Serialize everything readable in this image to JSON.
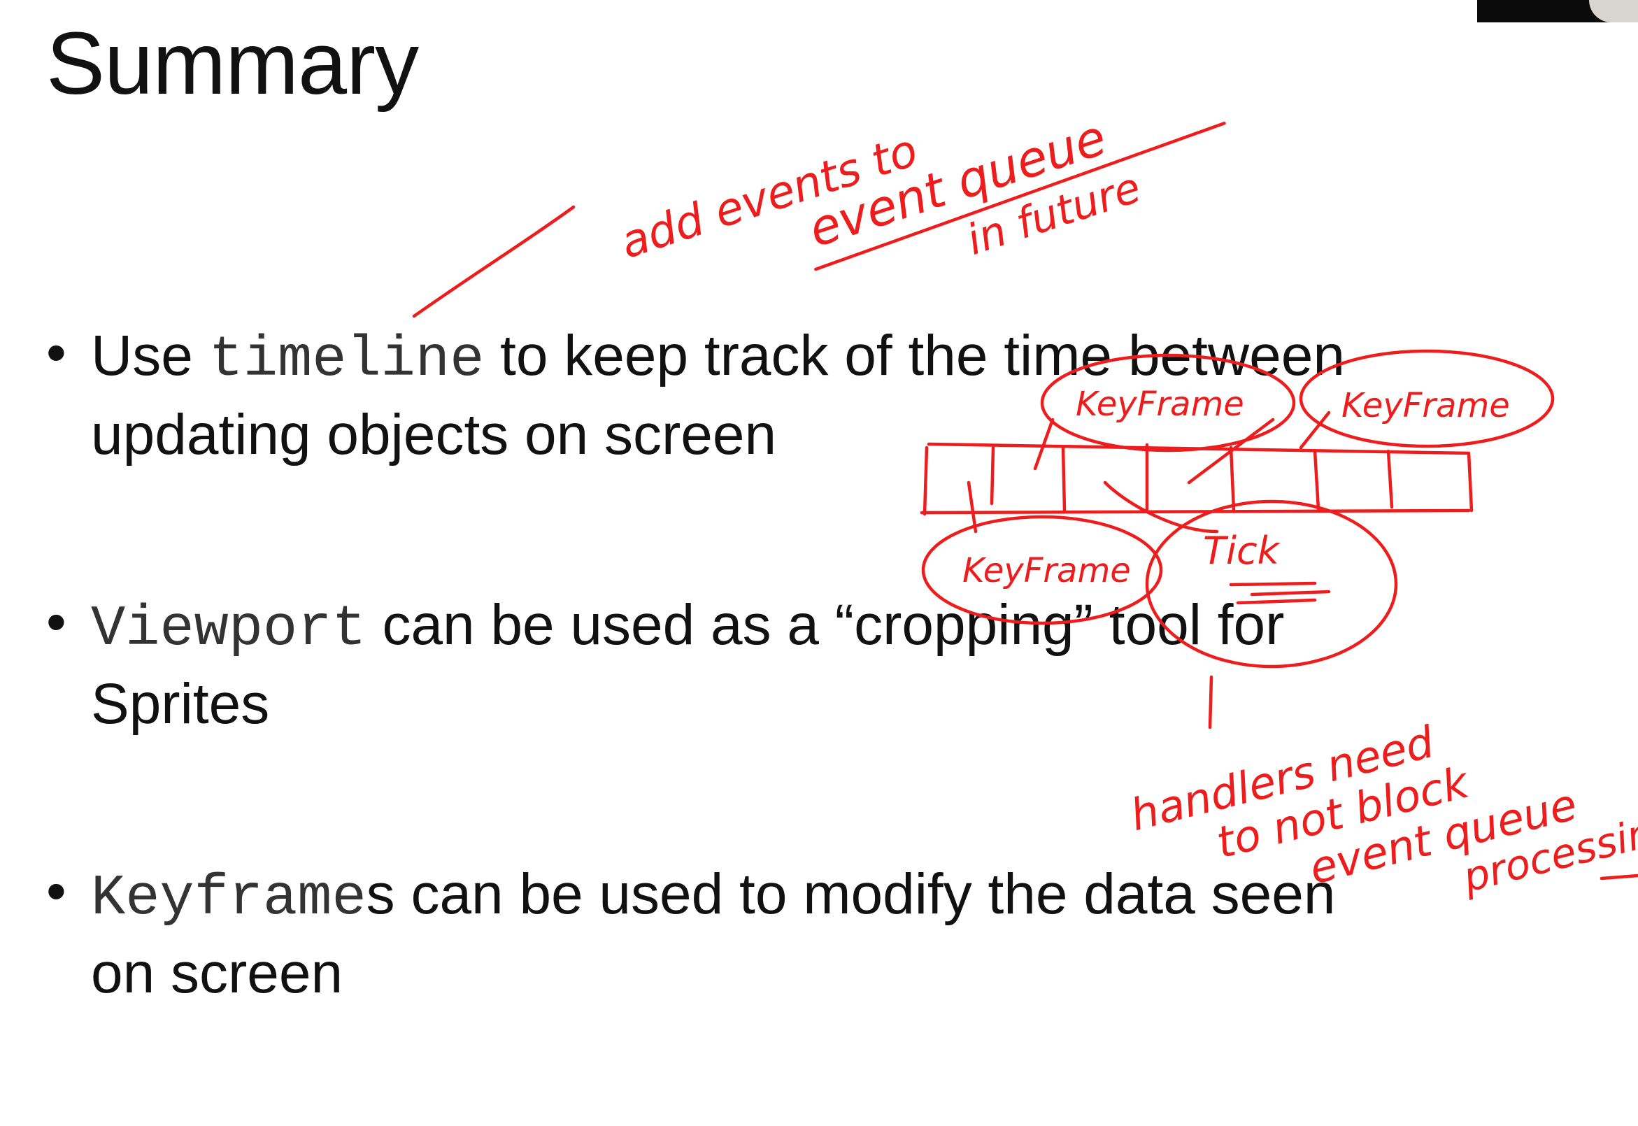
{
  "slide": {
    "title": "Summary",
    "bullets": [
      {
        "marker": "•",
        "code": "timeline",
        "line1": " to keep track of the time between",
        "line2": "updating objects on screen"
      },
      {
        "marker": "•",
        "code": "Viewport",
        "line1": " can be used as a “cropping” tool for",
        "line2": "Sprites"
      },
      {
        "marker": "•",
        "code": "Keyframe",
        "line1": "s can be used to modify the data seen",
        "line2": "on screen",
        "lead": ""
      }
    ]
  },
  "bullet1_lead": "Use ",
  "annotations": {
    "note_top_line1": "add events to",
    "note_top_line2": "event queue",
    "note_top_line3": "in future",
    "keyframe_a": "KeyFrame",
    "keyframe_b": "KeyFrame",
    "keyframe_c": "KeyFrame",
    "tick": "Tick",
    "note_bottom_line1": "handlers need",
    "note_bottom_line2": "to not block",
    "note_bottom_line3": "event queue",
    "note_bottom_line4": "processing",
    "ink_color": "#ee1d1d"
  }
}
